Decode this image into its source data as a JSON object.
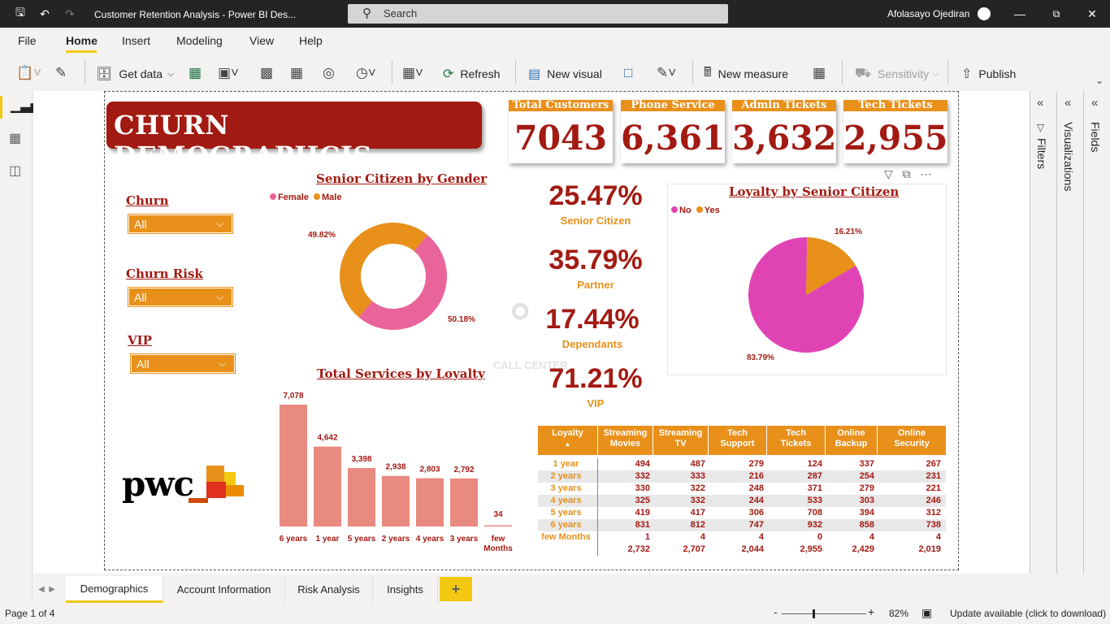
{
  "window": {
    "title": "Customer Retention Analysis - Power BI Des...",
    "search_placeholder": "Search",
    "user_name": "Afolasayo Ojediran"
  },
  "menu": [
    "File",
    "Home",
    "Insert",
    "Modeling",
    "View",
    "Help"
  ],
  "ribbon": {
    "get_data": "Get data",
    "refresh": "Refresh",
    "new_visual": "New visual",
    "new_measure": "New measure",
    "sensitivity": "Sensitivity",
    "publish": "Publish"
  },
  "panes": {
    "filters": "Filters",
    "visualizations": "Visualizations",
    "fields": "Fields"
  },
  "report": {
    "title": "CHURN DEMOGRAPHCIS",
    "kpis": [
      {
        "label": "Total Customers",
        "value": "7043"
      },
      {
        "label": "Phone Service",
        "value": "6,361"
      },
      {
        "label": "Admin Tickets",
        "value": "3,632"
      },
      {
        "label": "Tech Tickets",
        "value": "2,955"
      }
    ],
    "slicers": [
      {
        "label": "Churn",
        "value": "All"
      },
      {
        "label": "Churn Risk",
        "value": "All"
      },
      {
        "label": "VIP",
        "value": "All"
      }
    ],
    "senior_gender": {
      "title": "Senior Citizen by Gender",
      "legend": [
        "Female",
        "Male"
      ],
      "labels": [
        "49.82%",
        "50.18%"
      ]
    },
    "pct_kpis": [
      {
        "value": "25.47%",
        "label": "Senior Citizen"
      },
      {
        "value": "35.79%",
        "label": "Partner"
      },
      {
        "value": "17.44%",
        "label": "Dependants"
      },
      {
        "value": "71.21%",
        "label": "VIP"
      }
    ],
    "watermark_text": "CALL CENTER",
    "loyalty_senior": {
      "title": "Loyalty by Senior Citizen",
      "legend": [
        "No",
        "Yes"
      ],
      "labels": [
        "16.21%",
        "83.79%"
      ]
    },
    "services_chart": {
      "title": "Total Services by Loyalty"
    },
    "logo_text": "pwc",
    "table": {
      "headers": [
        [
          "Loyalty"
        ],
        [
          "Streaming",
          "Movies"
        ],
        [
          "Streaming",
          "TV"
        ],
        [
          "Tech",
          "Support"
        ],
        [
          "Tech",
          "Tickets"
        ],
        [
          "Online",
          "Backup"
        ],
        [
          "Online",
          "Security"
        ]
      ],
      "rows": [
        [
          "1 year",
          "494",
          "487",
          "279",
          "124",
          "337",
          "267"
        ],
        [
          "2 years",
          "332",
          "333",
          "216",
          "287",
          "254",
          "231"
        ],
        [
          "3 years",
          "330",
          "322",
          "248",
          "371",
          "279",
          "221"
        ],
        [
          "4 years",
          "325",
          "332",
          "244",
          "533",
          "303",
          "246"
        ],
        [
          "5 years",
          "419",
          "417",
          "306",
          "708",
          "394",
          "312"
        ],
        [
          "6 years",
          "831",
          "812",
          "747",
          "932",
          "858",
          "738"
        ],
        [
          "few Months",
          "1",
          "4",
          "4",
          "0",
          "4",
          "4"
        ]
      ],
      "totals": [
        "",
        "2,732",
        "2,707",
        "2,044",
        "2,955",
        "2,429",
        "2,019"
      ]
    }
  },
  "chart_data": [
    {
      "type": "pie",
      "title": "Senior Citizen by Gender",
      "categories": [
        "Female",
        "Male"
      ],
      "values": [
        50.18,
        49.82
      ],
      "colors": [
        "#e8649a",
        "#e8901a"
      ],
      "donut": true,
      "legend": "top-left"
    },
    {
      "type": "pie",
      "title": "Loyalty by Senior Citizen",
      "categories": [
        "No",
        "Yes"
      ],
      "values": [
        83.79,
        16.21
      ],
      "colors": [
        "#e044b4",
        "#e8901a"
      ],
      "legend": "top-left"
    },
    {
      "type": "bar",
      "title": "Total Services by Loyalty",
      "categories": [
        "6 years",
        "1 year",
        "5 years",
        "2 years",
        "4 years",
        "3 years",
        "few Months"
      ],
      "values": [
        7078,
        4642,
        3398,
        2938,
        2803,
        2792,
        34
      ],
      "data_labels": [
        "7,078",
        "4,642",
        "3,398",
        "2,938",
        "2,803",
        "2,792",
        "34"
      ],
      "color": "#e88a80",
      "ylim": [
        0,
        7078
      ]
    }
  ],
  "tabs": [
    "Demographics",
    "Account Information",
    "Risk Analysis",
    "Insights"
  ],
  "status": {
    "page": "Page 1 of 4",
    "zoom": "82%",
    "update": "Update available (click to download)"
  }
}
